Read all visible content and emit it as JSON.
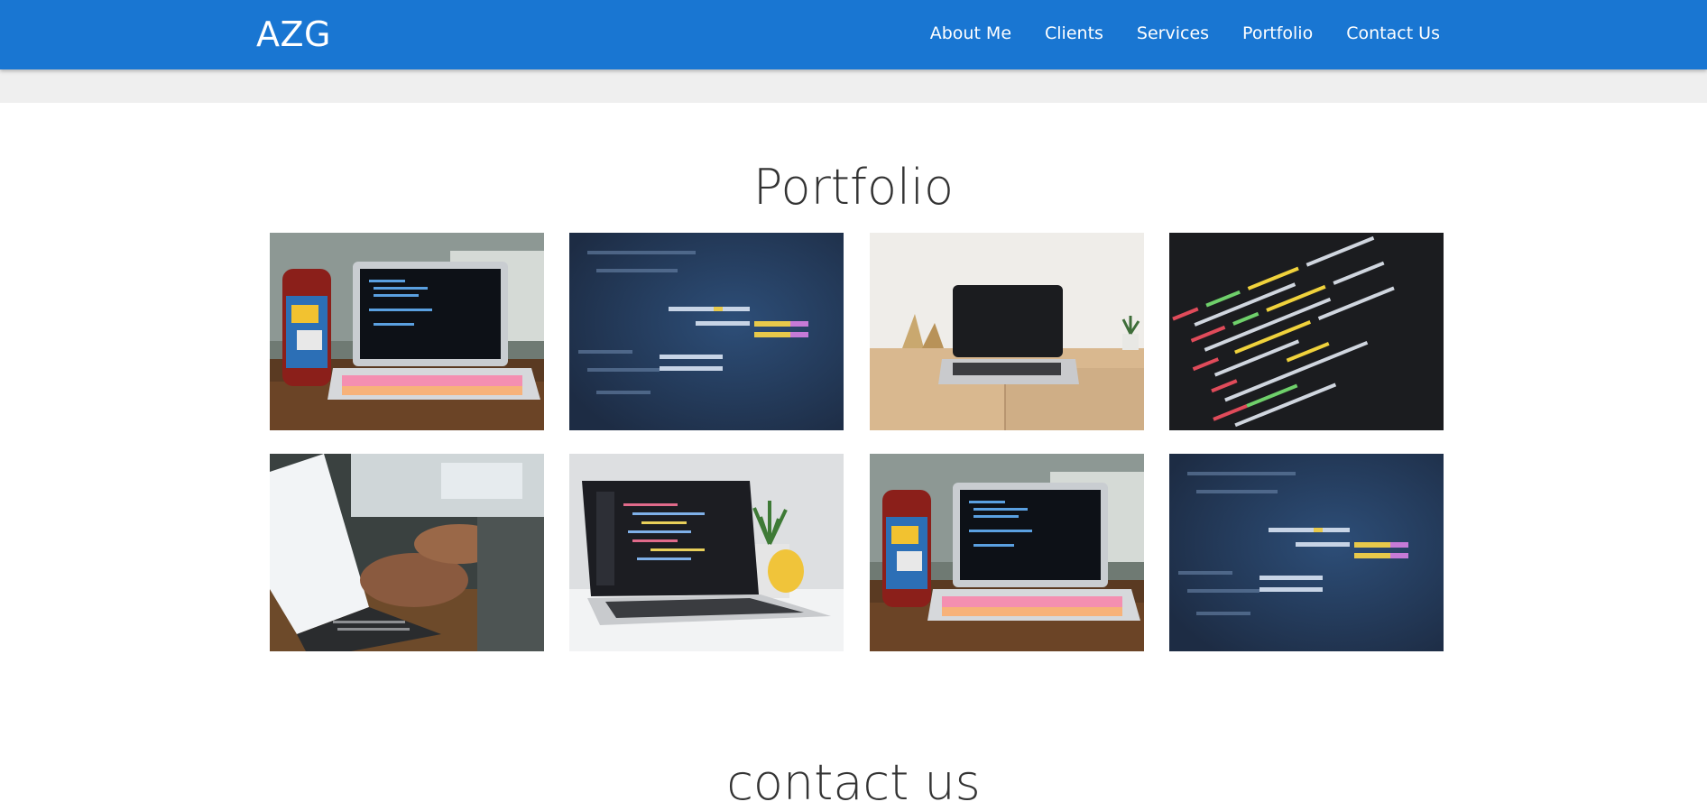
{
  "brand": "AZG",
  "nav": {
    "items": [
      "About Me",
      "Clients",
      "Services",
      "Portfolio",
      "Contact Us"
    ]
  },
  "portfolio": {
    "title": "Portfolio",
    "images": [
      "laptop-with-sticker-bottle-icon",
      "blurred-code-blue-icon",
      "laptop-on-wooden-desk-icon",
      "colorful-code-screen-icon",
      "hands-typing-laptop-icon",
      "laptop-with-plant-mug-icon",
      "laptop-with-sticker-bottle-icon",
      "blurred-code-blue-icon"
    ]
  },
  "contact": {
    "title": "contact us"
  },
  "colors": {
    "navbar": "#1976d2",
    "band": "#efefef",
    "heading": "#333333"
  }
}
